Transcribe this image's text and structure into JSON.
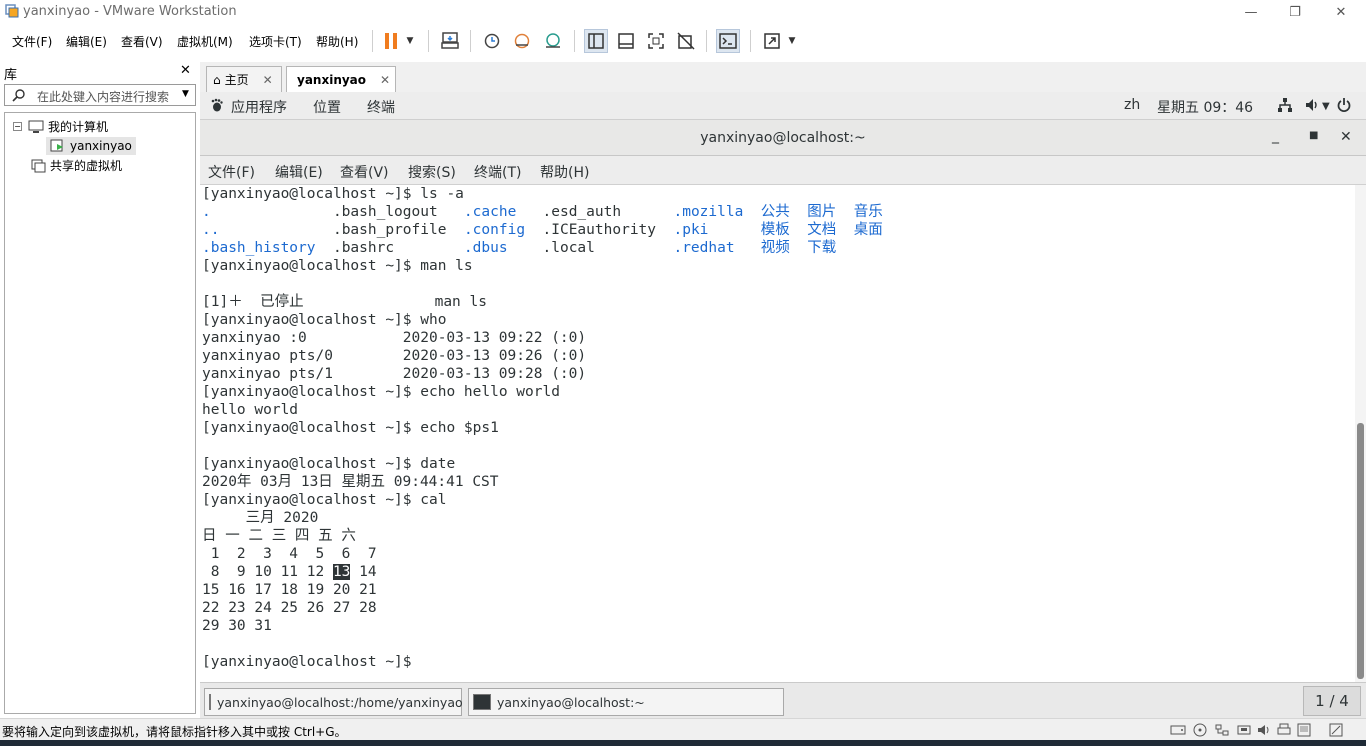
{
  "window": {
    "title": "yanxinyao - VMware Workstation",
    "icons": [
      "vmware-app-icon",
      "minimize-icon",
      "restore-icon",
      "close-icon"
    ]
  },
  "vmware_menu": [
    "文件(F)",
    "编辑(E)",
    "查看(V)",
    "虚拟机(M)",
    "选项卡(T)",
    "帮助(H)"
  ],
  "library": {
    "header": "库",
    "close": "✕",
    "search_placeholder": "在此处键入内容进行搜索",
    "tree": {
      "my_computer": "我的计算机",
      "vm": "yanxinyao",
      "shared": "共享的虚拟机"
    }
  },
  "tabs": {
    "home": "主页",
    "vm": "yanxinyao"
  },
  "gnome_top": {
    "apps": "应用程序",
    "places": "位置",
    "terminal": "终端",
    "lang": "zh",
    "clock": "星期五 09：46"
  },
  "terminal": {
    "title": "yanxinyao@localhost:~",
    "menu": [
      "文件(F)",
      "编辑(E)",
      "查看(V)",
      "搜索(S)",
      "终端(T)",
      "帮助(H)"
    ],
    "prompt": "[yanxinyao@localhost ~]$ ",
    "ls_cmd": "ls -a",
    "ls_rows": [
      [
        ".",
        ".bash_logout",
        ".cache",
        ".esd_auth",
        ".mozilla",
        "公共",
        "图片",
        "音乐"
      ],
      [
        "..",
        ".bash_profile",
        ".config",
        ".ICEauthority",
        ".pki",
        "模板",
        "文档",
        "桌面"
      ],
      [
        ".bash_history",
        ".bashrc",
        ".dbus",
        ".local",
        ".redhat",
        "视频",
        "下载",
        ""
      ]
    ],
    "man_cmd": "man ls",
    "job_line": "[1]＋  已停止               man ls",
    "who_cmd": "who",
    "who_lines": [
      "yanxinyao :0           2020-03-13 09:22 (:0)",
      "yanxinyao pts/0        2020-03-13 09:26 (:0)",
      "yanxinyao pts/1        2020-03-13 09:28 (:0)"
    ],
    "echo_cmd": "echo hello world",
    "echo_out": "hello world",
    "echo_ps_cmd": "echo $ps1",
    "date_cmd": "date",
    "date_out": "2020年 03月 13日 星期五 09:44:41 CST",
    "cal_cmd": "cal",
    "cal_header": "     三月 2020",
    "cal_weekdays": "日 一 二 三 四 五 六",
    "cal_week1": " 1  2  3  4  5  6  7",
    "cal_week2_before": " 8  9 10 11 12 ",
    "cal_today": "13",
    "cal_week2_after": " 14",
    "cal_week3": "15 16 17 18 19 20 21",
    "cal_week4": "22 23 24 25 26 27 28",
    "cal_week5": "29 30 31"
  },
  "taskbar": {
    "task1": "yanxinyao@localhost:/home/yanxinyao",
    "task2": "yanxinyao@localhost:~",
    "workspace": "1 / 4"
  },
  "status": {
    "message": "要将输入定向到该虚拟机，请将鼠标指针移入其中或按 Ctrl+G。"
  }
}
